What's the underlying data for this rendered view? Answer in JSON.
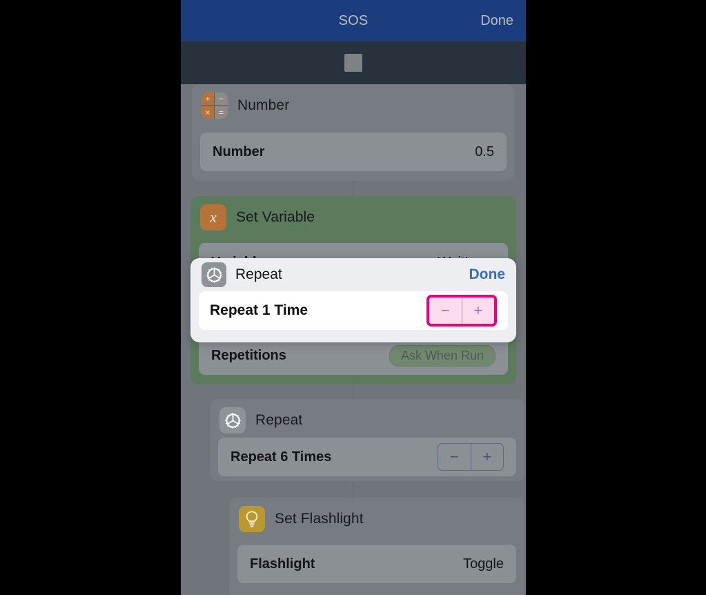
{
  "navbar": {
    "title": "SOS",
    "done_label": "Done"
  },
  "toolbar": {
    "stop_button": "stop-square"
  },
  "actions": [
    {
      "icon": "number-icon",
      "title": "Number",
      "row_label": "Number",
      "row_value": "0.5"
    },
    {
      "icon": "variable-icon",
      "title": "Set Variable",
      "row_label": "Variable",
      "row_value": "WaitLong",
      "row2_label": "Repetitions",
      "row2_token": "Ask When Run"
    },
    {
      "icon": "gear-icon",
      "title": "Repeat",
      "row_label": "Repeat 6 Times",
      "minus_label": "−",
      "plus_label": "+"
    },
    {
      "icon": "lightbulb-icon",
      "title": "Set Flashlight",
      "row_label": "Flashlight",
      "row_value": "Toggle"
    }
  ],
  "calculator_icon": {
    "plus": "+",
    "minus": "−",
    "times": "×",
    "equals": "="
  },
  "variable_icon": {
    "glyph": "x"
  },
  "popup": {
    "icon": "gear-icon",
    "title": "Repeat",
    "done_label": "Done",
    "row_label": "Repeat 1 Time",
    "minus_label": "−",
    "plus_label": "+"
  },
  "colors": {
    "navbar_bg": "#1c3d7d",
    "toolbar_bg": "#28323d",
    "page_bg": "#6f757b",
    "card_bg": "#767c82",
    "card_green_bg": "#5c7a5c",
    "highlight": "#e8007d",
    "link_blue": "#3c6cb5",
    "icon_orange": "#b5733a",
    "icon_gray": "#8e9398",
    "icon_gold": "#b9982f"
  }
}
